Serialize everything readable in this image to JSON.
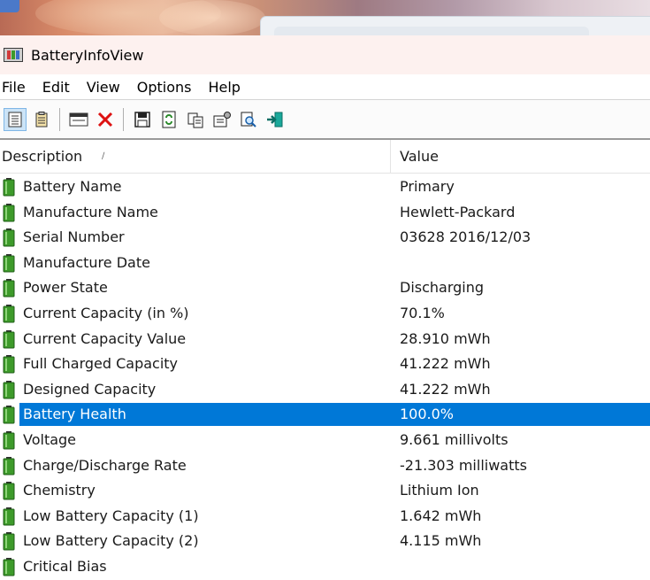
{
  "window": {
    "title": "BatteryInfoView"
  },
  "menu": [
    "File",
    "Edit",
    "View",
    "Options",
    "Help"
  ],
  "toolbar": {
    "buttons": [
      {
        "icon": "list-view-icon",
        "active": true
      },
      {
        "icon": "details-view-icon",
        "active": false
      },
      {
        "icon": "properties-window-icon",
        "active": false
      },
      {
        "icon": "delete-red-x-icon",
        "active": false
      },
      {
        "icon": "save-disk-icon",
        "active": false
      },
      {
        "icon": "refresh-icon",
        "active": false
      },
      {
        "icon": "copy-icon",
        "active": false
      },
      {
        "icon": "settings-properties-icon",
        "active": false
      },
      {
        "icon": "find-icon",
        "active": false
      },
      {
        "icon": "exit-icon",
        "active": false
      }
    ]
  },
  "columns": {
    "description": "Description",
    "value": "Value"
  },
  "rows": [
    {
      "description": "Battery Name",
      "value": "Primary"
    },
    {
      "description": "Manufacture Name",
      "value": "Hewlett-Packard"
    },
    {
      "description": "Serial Number",
      "value": "03628 2016/12/03"
    },
    {
      "description": "Manufacture Date",
      "value": ""
    },
    {
      "description": "Power State",
      "value": "Discharging"
    },
    {
      "description": "Current Capacity (in %)",
      "value": "70.1%"
    },
    {
      "description": "Current Capacity Value",
      "value": "28.910 mWh"
    },
    {
      "description": "Full Charged Capacity",
      "value": "41.222 mWh"
    },
    {
      "description": "Designed Capacity",
      "value": "41.222 mWh"
    },
    {
      "description": "Battery Health",
      "value": "100.0%",
      "selected": true
    },
    {
      "description": "Voltage",
      "value": "9.661 millivolts"
    },
    {
      "description": "Charge/Discharge Rate",
      "value": "-21.303 milliwatts"
    },
    {
      "description": "Chemistry",
      "value": "Lithium Ion"
    },
    {
      "description": "Low Battery Capacity (1)",
      "value": "1.642 mWh"
    },
    {
      "description": "Low Battery Capacity (2)",
      "value": "4.115 mWh"
    },
    {
      "description": "Critical Bias",
      "value": ""
    }
  ],
  "colors": {
    "selection": "#0078d7",
    "battery_green": "#3d9a2a"
  }
}
